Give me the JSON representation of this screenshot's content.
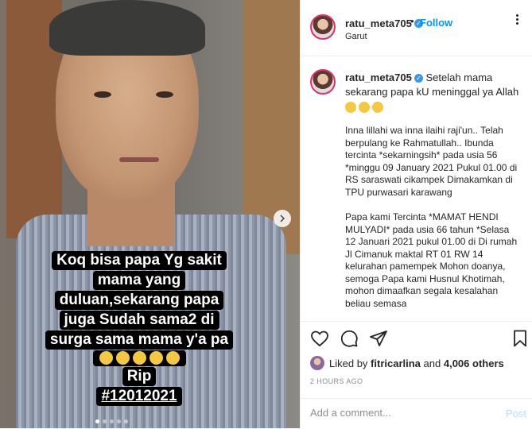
{
  "post": {
    "caption_overlay": {
      "lines": [
        "Koq bisa papa Yg sakit",
        "mama yang",
        "duluan,sekarang papa",
        "juga Sudah sama2 di",
        "surga sama mama y'a pa"
      ],
      "rip": "Rip",
      "hashtag": "#12012021"
    }
  },
  "header": {
    "username": "ratu_meta705",
    "dot": "•",
    "follow_label": "Follow",
    "location": "Garut"
  },
  "caption": {
    "username": "ratu_meta705",
    "first_line": "Setelah mama sekarang papa kU meninggal ya Allah",
    "para1": "Inna lillahi wa inna ilaihi raji'un.. Telah berpulang ke Rahmatullah.. Ibunda tercinta *sekarningsih* pada usia 56 *minggu 09 January 2021 Pukul 01.00 di RS saraswati cikampek Dimakamkan di TPU purwasari karawang",
    "para2": "Papa kami Tercinta *MAMAT HENDI MULYADI* pada usia 66 tahun *Selasa 12 Januari 2021 pukul 01.00 di Di rumah Jl Cimanuk maktal RT 01 RW 14 kelurahan pamempek Mohon doanya, semoga Papa kami Husnul Khotimah, mohon dimaafkan segala kesalahan beliau semasa"
  },
  "likes": {
    "prefix": "Liked by",
    "user": "fitricarlina",
    "and": "and",
    "count": "4,006 others"
  },
  "time": "2 HOURS AGO",
  "comment": {
    "placeholder": "Add a comment...",
    "post_label": "Post"
  },
  "colors": {
    "follow": "#0095f6",
    "verified": "#3897f0",
    "post_disabled": "#b2dffc"
  }
}
